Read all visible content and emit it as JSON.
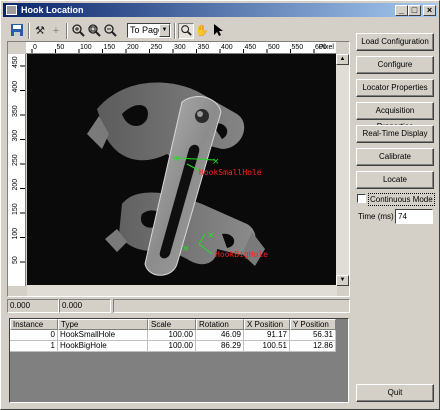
{
  "window": {
    "title": "Hook Location"
  },
  "toolbar": {
    "zoom_value": "To Page",
    "icons": [
      "save-icon",
      "tools-icon",
      "crosshair-icon",
      "zoom-in-icon",
      "zoom-fit-icon",
      "zoom-out-icon",
      "magnifier-icon",
      "hand-pan-icon",
      "pointer-icon"
    ]
  },
  "ruler": {
    "x_ticks": [
      "0",
      "50",
      "100",
      "150",
      "200",
      "250",
      "300",
      "350",
      "400",
      "450",
      "500",
      "550",
      "600"
    ],
    "x_unit": "Pixel",
    "y_ticks": [
      "450",
      "400",
      "350",
      "300",
      "250",
      "200",
      "150",
      "100",
      "50"
    ]
  },
  "overlay": {
    "label_small": "HookSmallHole",
    "label_big": "HookBigHole",
    "label_color": "#ff2020",
    "marker_color": "#20e020"
  },
  "status": {
    "left": "0.000",
    "right": "0.000"
  },
  "results": {
    "columns": [
      "Instance",
      "Type",
      "Scale",
      "Rotation",
      "X Position",
      "Y Position"
    ],
    "rows": [
      [
        "0",
        "HookSmallHole",
        "100.00",
        "46.09",
        "91.17",
        "56.31"
      ],
      [
        "1",
        "HookBigHole",
        "100.00",
        "86.29",
        "100.51",
        "12.86"
      ]
    ]
  },
  "buttons": {
    "load": "Load Configuration",
    "configure": "Configure",
    "locator": "Locator Properties",
    "acquisition": "Acquisition Properties",
    "realtime": "Real-Time Display",
    "calibrate": "Calibrate",
    "locate": "Locate",
    "quit": "Quit"
  },
  "continuous_mode": {
    "label": "Continuous Mode",
    "checked": false
  },
  "time": {
    "label": "Time (ms)",
    "value": "74"
  }
}
